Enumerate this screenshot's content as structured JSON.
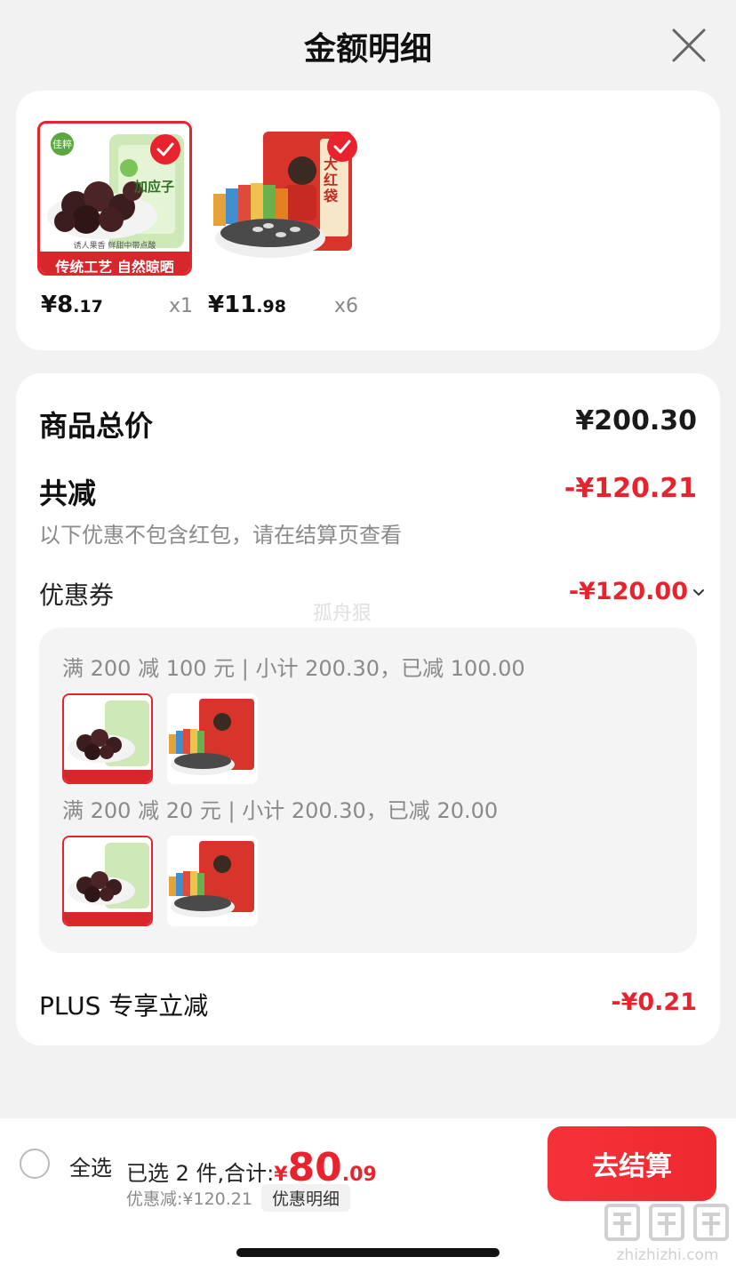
{
  "header": {
    "title": "金额明细",
    "close_icon": "close-icon"
  },
  "products": [
    {
      "price_int": "¥8",
      "price_dec": ".17",
      "qty": "x1",
      "banner": "传统工艺 自然晾晒",
      "bag_text": "加应子",
      "sub_text": "诱人果香 鲜甜中带点酸",
      "brand": "佳粹"
    },
    {
      "price_int": "¥11",
      "price_dec": ".98",
      "qty": "x6",
      "bag_text": "大红袋"
    }
  ],
  "detail": {
    "total_label": "商品总价",
    "total_value": "¥200.30",
    "reduce_label": "共减",
    "reduce_value": "-¥120.21",
    "reduce_note": "以下优惠不包含红包，请在结算页查看",
    "coupon_label": "优惠券",
    "coupon_value": "-¥120.00",
    "tiers": [
      {
        "title": "满 200 减 100 元 | 小计 200.30，已减 100.00"
      },
      {
        "title": "满 200 减 20 元 | 小计 200.30，已减 20.00"
      }
    ],
    "plus_label": "PLUS 专享立减",
    "plus_value": "-¥0.21"
  },
  "watermark": "孤舟狠",
  "bottom": {
    "select_all": "全选",
    "selected_text": "已选 2 件,合计:",
    "currency": "¥",
    "total_int": "80",
    "total_dec": ".09",
    "discount_text": "优惠减:¥120.21",
    "detail_link": "优惠明细",
    "checkout": "去结算"
  },
  "site_watermark": "zhizhizhi.com",
  "colors": {
    "accent": "#e8232d",
    "card": "#ffffff",
    "background": "#f2f2f2"
  }
}
